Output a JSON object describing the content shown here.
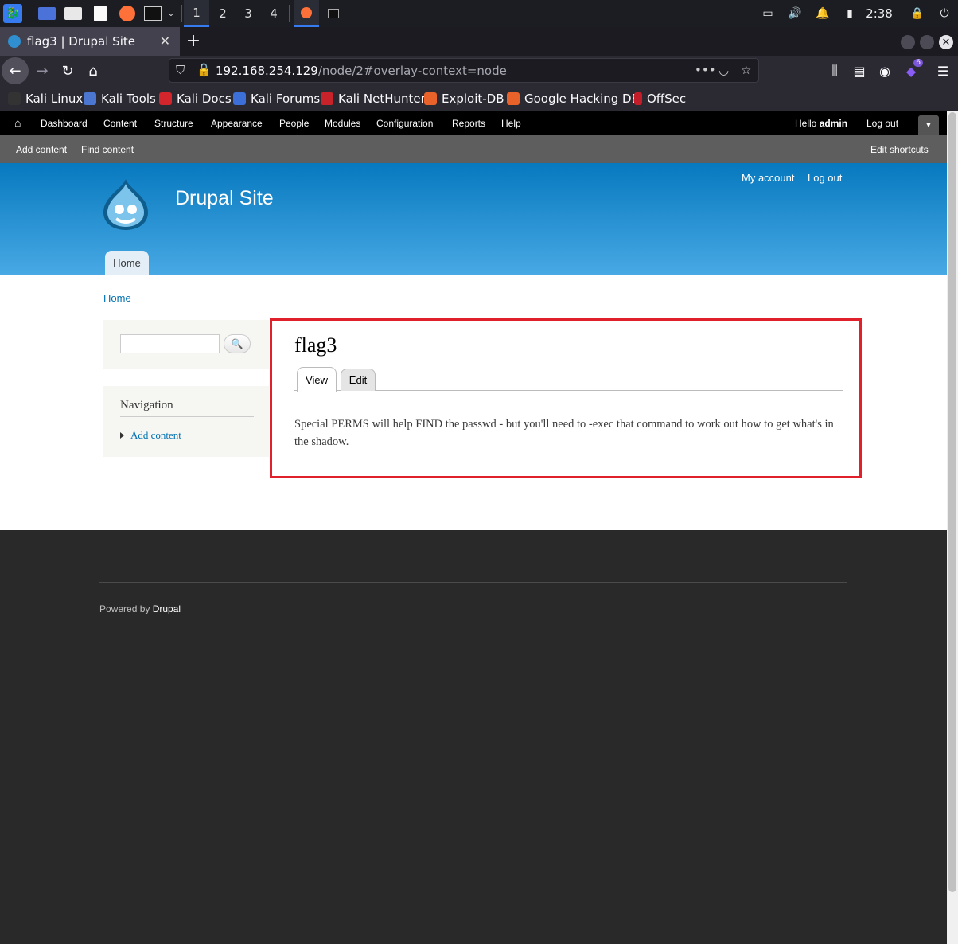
{
  "taskbar": {
    "workspaces": [
      "1",
      "2",
      "3",
      "4"
    ],
    "clock": "2:38"
  },
  "browser": {
    "tab_title": "flag3 | Drupal Site",
    "url_host": "192.168.254.129",
    "url_path": "/node/2#overlay-context=node",
    "extension_badge": "6",
    "bookmarks": [
      "Kali Linux",
      "Kali Tools",
      "Kali Docs",
      "Kali Forums",
      "Kali NetHunter",
      "Exploit-DB",
      "Google Hacking DB",
      "OffSec"
    ]
  },
  "admin_toolbar": {
    "items": [
      "Dashboard",
      "Content",
      "Structure",
      "Appearance",
      "People",
      "Modules",
      "Configuration",
      "Reports",
      "Help"
    ],
    "hello": "Hello ",
    "user": "admin",
    "logout": "Log out",
    "shortcuts": [
      "Add content",
      "Find content"
    ],
    "edit_shortcuts": "Edit shortcuts"
  },
  "site": {
    "name": "Drupal Site",
    "secondary_menu": [
      "My account",
      "Log out"
    ],
    "main_menu": [
      "Home"
    ],
    "breadcrumb": "Home"
  },
  "sidebar": {
    "nav_title": "Navigation",
    "nav_items": [
      "Add content"
    ]
  },
  "node": {
    "title": "flag3",
    "tabs": [
      "View",
      "Edit"
    ],
    "body": "Special PERMS will help FIND the passwd - but you'll need to -exec that command to work out how to get what's in the shadow."
  },
  "footer": {
    "powered_prefix": "Powered by ",
    "powered_link": "Drupal"
  },
  "colors": {
    "highlight": "#e0202a",
    "header_top": "#0779bf",
    "header_bottom": "#48a9e4",
    "link": "#0071b3"
  }
}
